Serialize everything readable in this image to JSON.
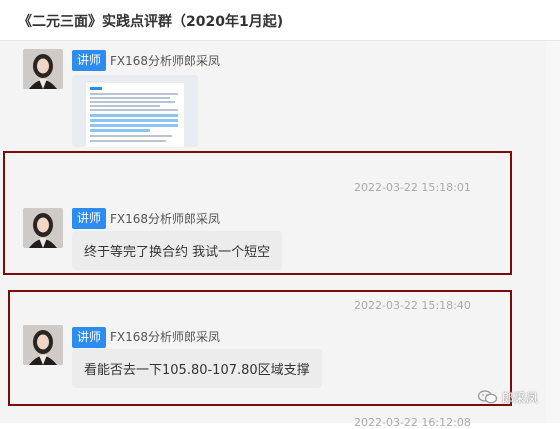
{
  "header": {
    "title": "《二元三面》实践点评群（2020年1月起)"
  },
  "messages": [
    {
      "badge": "讲师",
      "sender": "FX168分析师郎采凤",
      "type": "image"
    },
    {
      "timestamp": "2022-03-22 15:18:01",
      "badge": "讲师",
      "sender": "FX168分析师郎采凤",
      "text": "终于等完了换合约 我试一个短空"
    },
    {
      "timestamp": "2022-03-22 15:18:40",
      "badge": "讲师",
      "sender": "FX168分析师郎采凤",
      "text": "看能否去一下105.80-107.80区域支撑"
    },
    {
      "timestamp": "2022-03-22 16:12:08"
    }
  ],
  "watermark": {
    "icon": "wechat-icon",
    "text": "郎采凤"
  },
  "colors": {
    "badge": "#2d8cf0",
    "highlight_border": "#7b0c0c",
    "bubble": "#ececec"
  }
}
